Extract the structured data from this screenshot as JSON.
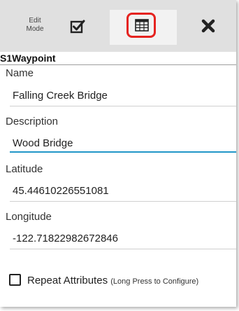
{
  "toolbar": {
    "edit_mode_line1": "Edit",
    "edit_mode_line2": "Mode",
    "icons": [
      "checkbox-check-icon",
      "table-grid-icon",
      "close-icon"
    ],
    "highlight_color": "#e52320"
  },
  "form": {
    "title": "S1Waypoint",
    "fields": [
      {
        "label": "Name",
        "value": "Falling Creek Bridge"
      },
      {
        "label": "Description",
        "value": "Wood Bridge"
      },
      {
        "label": "Latitude",
        "value": "45.44610226551081"
      },
      {
        "label": "Longitude",
        "value": "-122.71822982672846"
      }
    ],
    "repeat_attributes": {
      "label": "Repeat Attributes",
      "hint": "(Long Press to Configure)",
      "checked": false
    },
    "active_field_color": "#2196c8"
  }
}
